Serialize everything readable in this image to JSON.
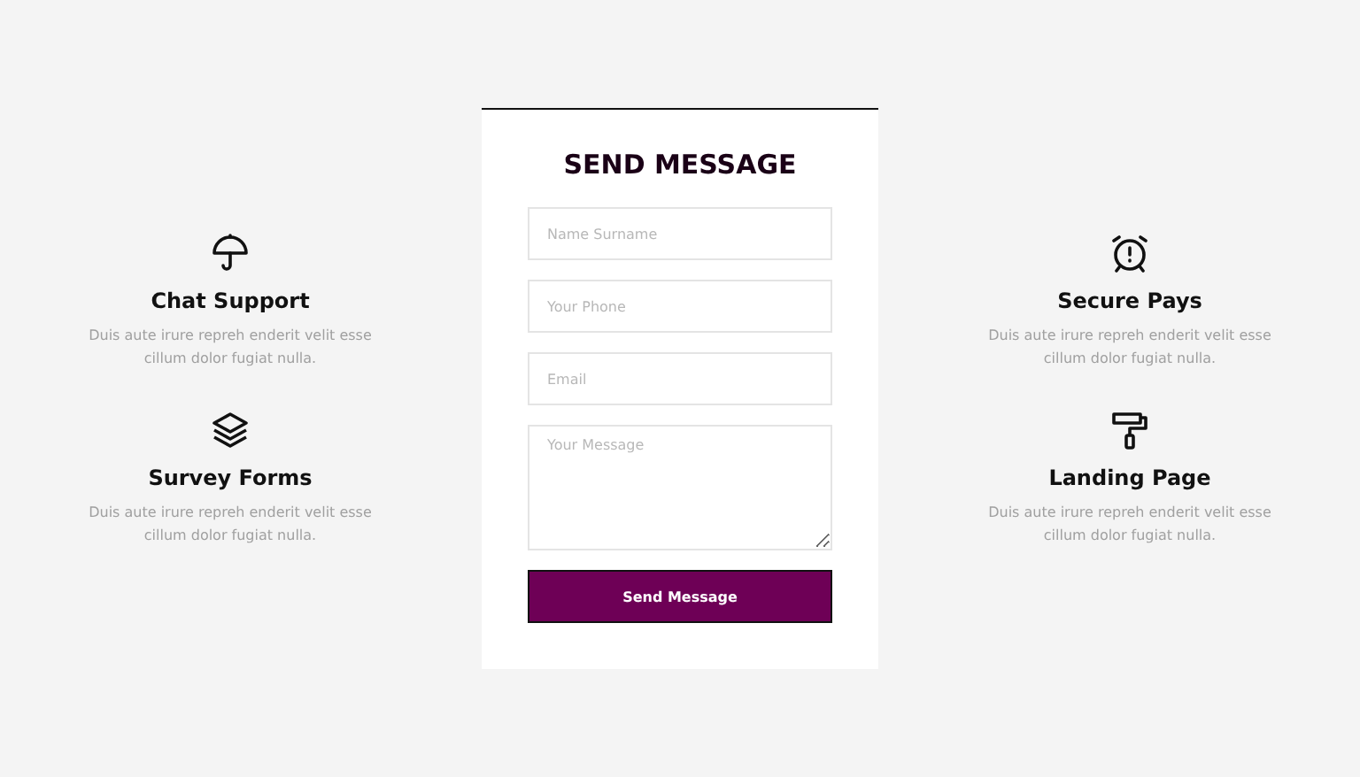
{
  "features_left": [
    {
      "kind": "umbrella",
      "title": "Chat Support",
      "text": "Duis aute irure repreh enderit velit esse cillum dolor fugiat nulla."
    },
    {
      "kind": "layers",
      "title": "Survey Forms",
      "text": "Duis aute irure repreh enderit velit esse cillum dolor fugiat nulla."
    }
  ],
  "form": {
    "title": "SEND MESSAGE",
    "fields": [
      {
        "kind": "input",
        "placeholder": "Name Surname"
      },
      {
        "kind": "input",
        "placeholder": "Your Phone"
      },
      {
        "kind": "input",
        "placeholder": "Email"
      },
      {
        "kind": "textarea",
        "placeholder": "Your Message"
      }
    ],
    "button": "Send Message"
  },
  "features_right": [
    {
      "kind": "alarm",
      "title": "Secure Pays",
      "text": "Duis aute irure repreh enderit velit esse cillum dolor fugiat nulla."
    },
    {
      "kind": "roller",
      "title": "Landing Page",
      "text": "Duis aute irure repreh enderit velit esse cillum dolor fugiat nulla."
    }
  ]
}
